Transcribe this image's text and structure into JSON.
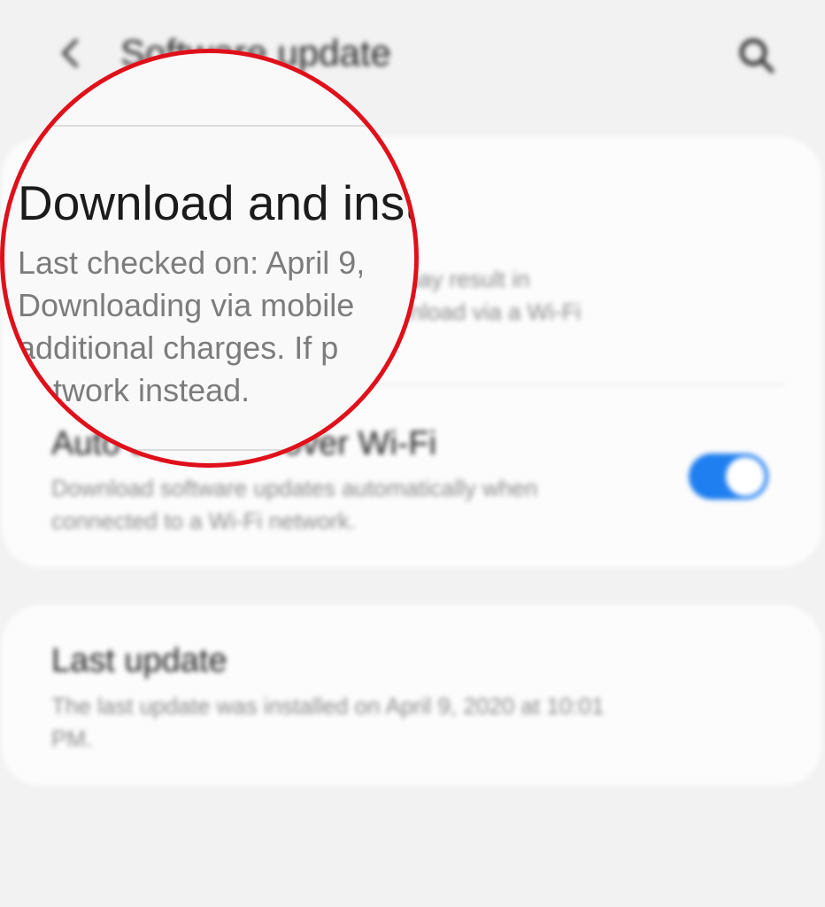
{
  "header": {
    "title": "Software update",
    "back_icon": "back-arrow-icon",
    "search_icon": "search-icon"
  },
  "download_install": {
    "title": "Download and install",
    "subtitle_blurred_lines": [
      "Last checked on: April 9,",
      "Downloading via mobile networks may result in",
      "additional charges. If possible, download via a Wi-Fi",
      "network instead."
    ],
    "magnified_lines": [
      "Last checked on: April 9,",
      "Downloading via mobile",
      "additional charges. If p",
      "network instead."
    ]
  },
  "auto_download": {
    "title": "Auto download over Wi-Fi",
    "subtitle_lines": [
      "Download software updates automatically when",
      "connected to a Wi-Fi network."
    ],
    "enabled": true,
    "accent_color": "#1f7ff0"
  },
  "last_update": {
    "title": "Last update",
    "subtitle_lines": [
      "The last update was installed on April 9, 2020 at 10:01",
      "PM."
    ]
  },
  "highlight": {
    "ring_color": "#e0101a"
  }
}
